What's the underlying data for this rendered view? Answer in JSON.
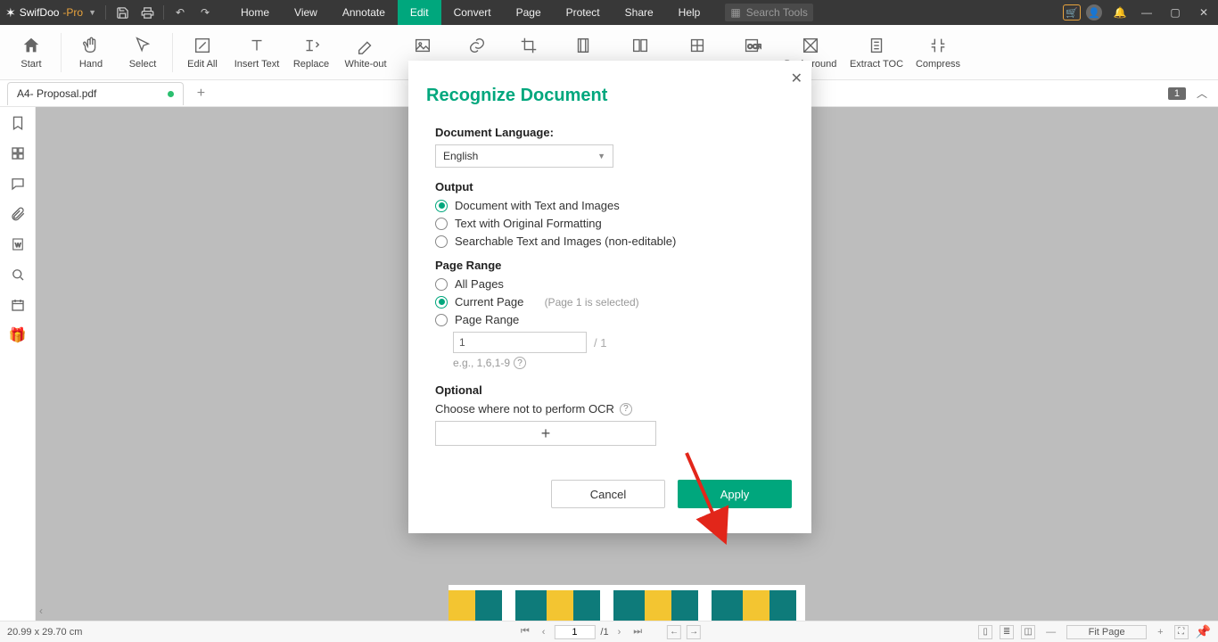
{
  "app": {
    "name1": "SwifDoo",
    "name2": "-Pro"
  },
  "menu": [
    "Home",
    "View",
    "Annotate",
    "Edit",
    "Convert",
    "Page",
    "Protect",
    "Share",
    "Help"
  ],
  "menu_active_index": 3,
  "search_placeholder": "Search Tools",
  "ribbon": [
    "Start",
    "Hand",
    "Select",
    "Edit All",
    "Insert Text",
    "Replace",
    "White-out",
    "Add Image",
    "Link",
    "Crop",
    "Page Setup",
    "Split Page",
    "Background",
    "OCR",
    "Background",
    "Extract TOC",
    "Compress"
  ],
  "tab": {
    "name": "A4- Proposal.pdf"
  },
  "page_badge": "1",
  "dialog": {
    "title": "Recognize Document",
    "lang_label": "Document Language:",
    "lang_value": "English",
    "output_label": "Output",
    "output_opts": [
      "Document with Text and Images",
      "Text with Original Formatting",
      "Searchable Text and Images (non-editable)"
    ],
    "range_label": "Page Range",
    "range_all": "All Pages",
    "range_current": "Current Page",
    "range_current_hint": "(Page 1 is selected)",
    "range_range": "Page Range",
    "range_value": "1",
    "range_total": "/ 1",
    "range_eg": "e.g., 1,6,1-9",
    "optional_label": "Optional",
    "optional_text": "Choose where not to perform OCR",
    "cancel": "Cancel",
    "apply": "Apply"
  },
  "status": {
    "dims": "20.99 x 29.70 cm",
    "page": "1",
    "total": "/1",
    "zoom": "Fit Page"
  }
}
